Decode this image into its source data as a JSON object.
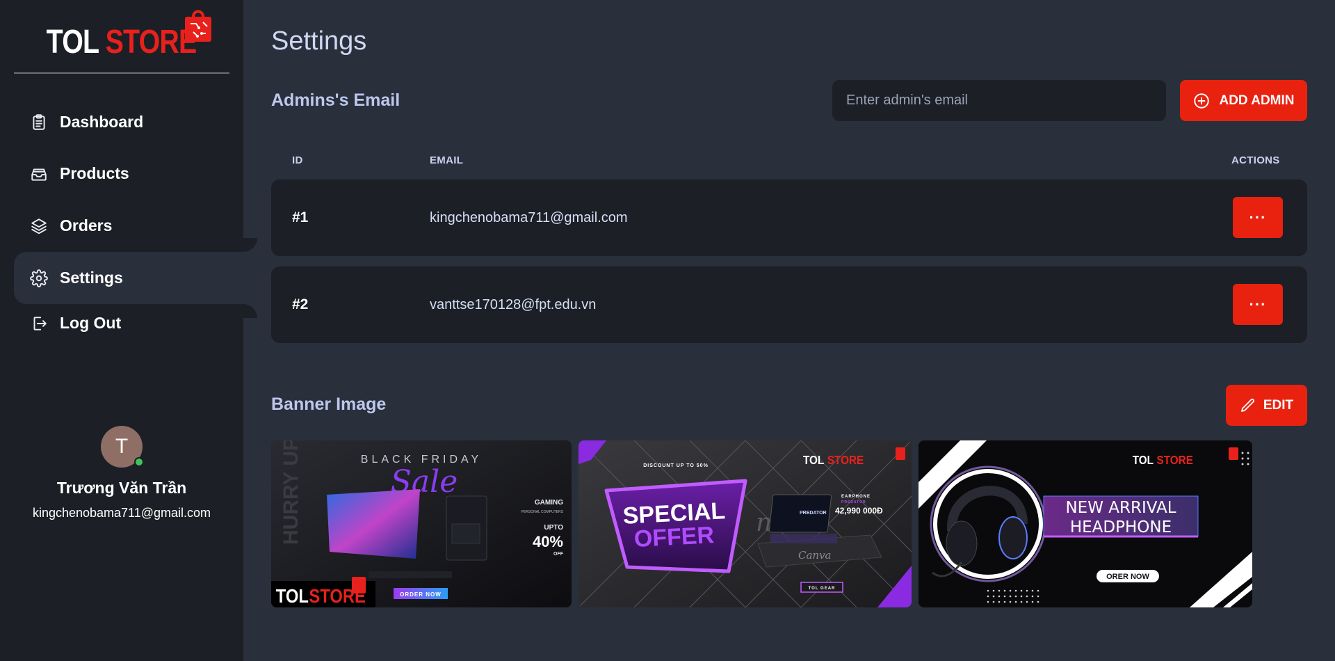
{
  "sidebar": {
    "brand": {
      "word1": "TOL",
      "word2": "STORE"
    },
    "nav": [
      {
        "label": "Dashboard",
        "icon": "clipboard-icon"
      },
      {
        "label": "Products",
        "icon": "inbox-icon"
      },
      {
        "label": "Orders",
        "icon": "layers-icon"
      },
      {
        "label": "Settings",
        "icon": "gear-icon",
        "active": true
      },
      {
        "label": "Log Out",
        "icon": "logout-icon"
      }
    ],
    "user": {
      "initial": "T",
      "name": "Trương Văn Trần",
      "email": "kingchenobama711@gmail.com",
      "status_color": "#3ec45a"
    }
  },
  "main": {
    "title": "Settings",
    "admins": {
      "title": "Admins's Email",
      "input_placeholder": "Enter admin's email",
      "add_label": "ADD ADMIN",
      "columns": {
        "id": "ID",
        "email": "EMAIL",
        "actions": "ACTIONS"
      },
      "rows": [
        {
          "id": "#1",
          "email": "kingchenobama711@gmail.com",
          "action": "···"
        },
        {
          "id": "#2",
          "email": "vanttse170128@fpt.edu.vn",
          "action": "···"
        }
      ]
    },
    "banner": {
      "title": "Banner Image",
      "edit_label": "EDIT",
      "images": [
        {
          "headline1": "BLACK FRIDAY",
          "headline2": "Sale",
          "side1": "GAMING",
          "side2": "PERSONAL COMPUTERS",
          "upto": "UPTO",
          "percent": "40%",
          "off": "OFF",
          "cta": "ORDER NOW",
          "vertical": "HURRY UP!",
          "brand1": "TOL",
          "brand2": "STORE"
        },
        {
          "top": "DISCOUNT UP TO 50%",
          "headline1": "SPECIAL",
          "headline2": "OFFER",
          "product": "EARPHONE",
          "product2": "PREDATOR",
          "price": "42,990 000Đ",
          "cta": "TOL GEAR",
          "watermark": "Canva",
          "screen": "PREDATOR",
          "brand1": "TOL",
          "brand2": "STORE"
        },
        {
          "line1": "NEW ARRIVAL",
          "line2": "HEADPHONE",
          "cta": "ORER NOW",
          "brand1": "TOL",
          "brand2": "STORE"
        }
      ]
    }
  },
  "colors": {
    "accent": "#e8220f",
    "sidebar_bg": "#1c1f26",
    "main_bg": "#2a2f3c",
    "title": "#cfd8f2"
  }
}
